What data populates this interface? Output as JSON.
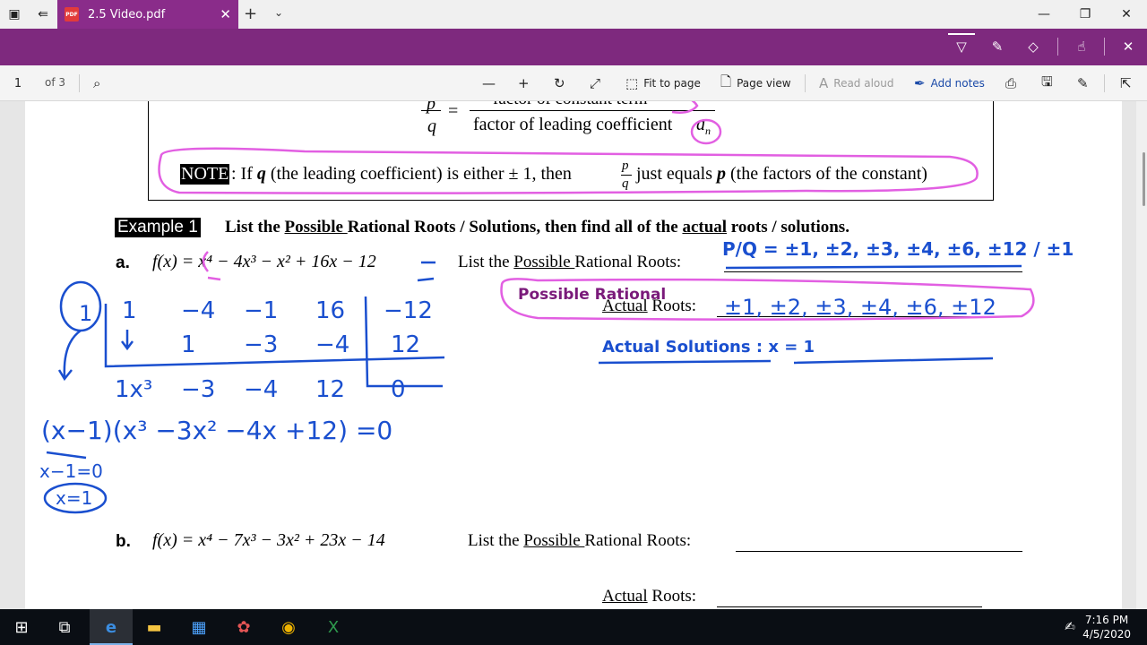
{
  "window": {
    "tab_title": "2.5 Video.pdf",
    "file_badge": "PDF",
    "minimize": "—",
    "restore": "❐",
    "close": "✕"
  },
  "toolbar": {
    "page_number": "1",
    "page_of": "of 3",
    "fit_to_page": "Fit to page",
    "page_view": "Page view",
    "read_aloud": "Read aloud",
    "add_notes": "Add notes"
  },
  "document": {
    "formula_p": "p",
    "formula_q": "q",
    "formula_eq": "=",
    "formula_numerator": "factor of constant term",
    "formula_denominator": "factor of leading coefficient",
    "formula_an": "a",
    "formula_an_sub": "n",
    "note_label": "NOTE",
    "note_text_1": ":  If ",
    "note_q": "q",
    "note_text_2": " (the leading coefficient) is either ± 1, then ",
    "note_text_3": " just equals ",
    "note_p": "p",
    "note_text_4": " (the factors of the constant)",
    "example_label": "Example 1",
    "example_instruction_1": "List the ",
    "example_possible": "Possible ",
    "example_instruction_2": "Rational Roots / Solutions, then find all of the ",
    "example_actual": "actual",
    "example_instruction_3": " roots / solutions.",
    "part_a_label": "a.",
    "part_a_function": "f(x) = x⁴ − 4x³ − x² + 16x − 12",
    "part_a_list_1": "List the ",
    "part_a_possible": "Possible ",
    "part_a_list_2": "Rational Roots:",
    "part_a_actual": "Actual",
    "part_a_roots": " Roots:",
    "part_b_label": "b.",
    "part_b_function": "f(x) = x⁴ − 7x³ − 3x² + 23x − 14",
    "part_b_list_1": "List the ",
    "part_b_possible": "Possible ",
    "part_b_list_2": "Rational Roots:",
    "part_b_actual": "Actual",
    "part_b_roots": " Roots:"
  },
  "handwriting": {
    "pq_list": "P/Q = ±1, ±2, ±3, ±4, ±6, ±12 / ±1",
    "possible_rational": "Possible Rational",
    "possible_roots": "±1, ±2, ±3, ±4, ±6, ±12",
    "actual_solutions": "Actual Solutions : x = 1",
    "synthetic_root": "1",
    "synthetic_row1": [
      "1",
      "−4",
      "−1",
      "16",
      "−12"
    ],
    "synthetic_row2": [
      "1",
      "−3",
      "−4",
      "12"
    ],
    "synthetic_result": [
      "1x³",
      "−3",
      "−4",
      "12",
      "0"
    ],
    "factored": "(x−1)(x³ −3x² −4x +12) =0",
    "solve_step": "x−1=0",
    "solution": "x=1"
  },
  "taskbar": {
    "time": "7:16 PM",
    "date": "4/5/2020"
  },
  "colors": {
    "accent_purple": "#7e297e",
    "ink_blue": "#1a4fcf",
    "ink_pink": "#e25fe2"
  }
}
